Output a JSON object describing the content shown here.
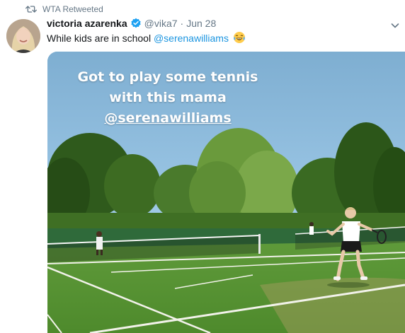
{
  "retweet": {
    "label": "WTA Retweeted",
    "icon": "retweet-icon"
  },
  "tweet": {
    "author_name": "victoria azarenka",
    "verified": true,
    "handle": "@vika7",
    "separator": "·",
    "date": "Jun 28",
    "text_prefix": "While kids are in school ",
    "mention": "@serenawilliams",
    "emoji": "face-with-tears-of-joy"
  },
  "media": {
    "caption_line1": "Got to play some tennis",
    "caption_line2": "with this mama",
    "caption_mention": "@serenawilliams"
  },
  "colors": {
    "link": "#1b95e0",
    "muted": "#657786",
    "verified": "#1da1f2"
  }
}
